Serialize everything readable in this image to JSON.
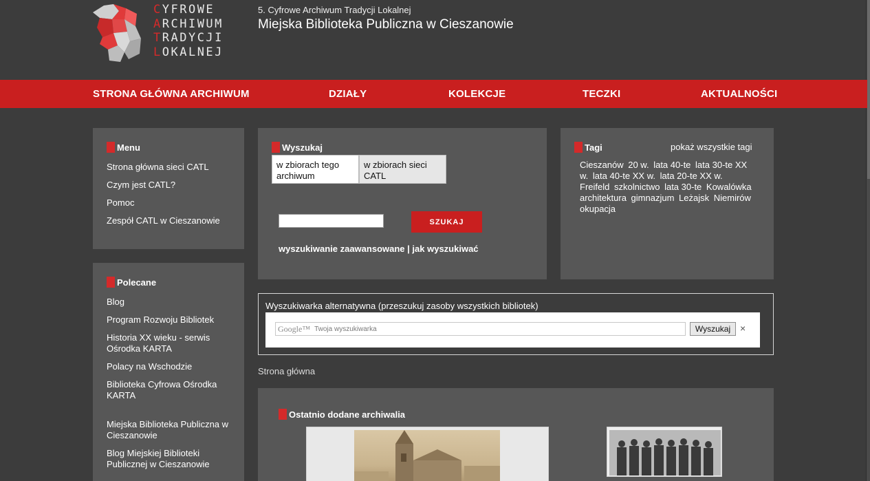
{
  "header": {
    "logo_lines": [
      {
        "initial": "C",
        "rest": "YFROWE"
      },
      {
        "initial": "A",
        "rest": "RCHIWUM"
      },
      {
        "initial": "T",
        "rest": "RADYCJI"
      },
      {
        "initial": "L",
        "rest": "OKALNEJ"
      }
    ],
    "subtitle": "5. Cyfrowe Archiwum Tradycji Lokalnej",
    "title": "Miejska Biblioteka Publiczna w Cieszanowie"
  },
  "nav": {
    "items": [
      {
        "label": "STRONA GŁÓWNA ARCHIWUM"
      },
      {
        "label": "DZIAŁY"
      },
      {
        "label": "KOLEKCJE"
      },
      {
        "label": "TECZKI"
      },
      {
        "label": "AKTUALNOŚCI"
      }
    ]
  },
  "menu": {
    "title": "Menu",
    "items": [
      {
        "label": "Strona główna sieci CATL"
      },
      {
        "label": "Czym jest CATL?"
      },
      {
        "label": "Pomoc"
      },
      {
        "label": "Zespół CATL w Cieszanowie"
      }
    ]
  },
  "polecane": {
    "title": "Polecane",
    "items": [
      {
        "label": "Blog"
      },
      {
        "label": "Program Rozwoju Bibliotek"
      },
      {
        "label": "Historia XX wieku - serwis Ośrodka KARTA"
      },
      {
        "label": "Polacy na Wschodzie"
      },
      {
        "label": "Biblioteka Cyfrowa Ośrodka KARTA"
      },
      {
        "label": "Miejska Biblioteka Publiczna w Cieszanowie"
      },
      {
        "label": "Blog Miejskiej Biblioteki Publicznej w Cieszanowie"
      }
    ]
  },
  "search": {
    "title": "Wyszukaj",
    "scope_local": "w zbiorach tego archiwum",
    "scope_network": "w zbiorach sieci CATL",
    "input_value": "",
    "button_label": "SZUKAJ",
    "advanced_label": "wyszukiwanie zaawansowane",
    "separator": "|",
    "howto_label": "jak wyszukiwać"
  },
  "tags": {
    "title": "Tagi",
    "show_all": "pokaż wszystkie tagi",
    "items": [
      "Cieszanów",
      "20 w.",
      "lata 40-te",
      "lata 30-te XX w.",
      "lata 40-te XX w.",
      "lata 20-te XX w.",
      "Freifeld",
      "szkolnictwo",
      "lata 30-te",
      "Kowalówka",
      "architektura",
      "gimnazjum",
      "Leżajsk",
      "Niemirów",
      "okupacja"
    ]
  },
  "alt_search": {
    "title": "Wyszukiwarka alternatywna (przeszukuj zasoby wszystkich bibliotek)",
    "brand": "Google™",
    "placeholder": "Twoja wyszukiwarka",
    "button_label": "Wyszukaj",
    "close_glyph": "×"
  },
  "breadcrumb": "Strona główna",
  "recent": {
    "title": "Ostatnio dodane archiwalia"
  },
  "colors": {
    "accent": "#c91f1f",
    "background": "#3c3c3c",
    "panel": "#575757"
  }
}
